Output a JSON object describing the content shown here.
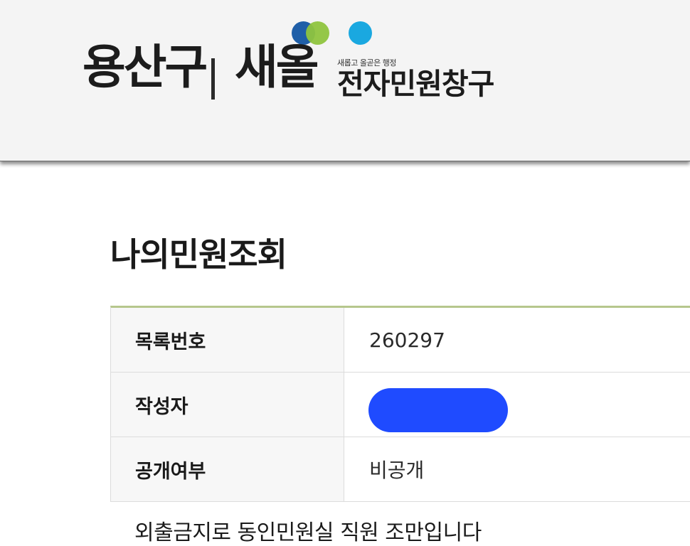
{
  "header": {
    "district_name": "용산구",
    "brand_name": "새올",
    "tagline": "새롭고 올곧은 행정",
    "service_name": "전자민원창구",
    "dot_colors": [
      "#1f5fa8",
      "#8fc43e",
      "#1aa8e0"
    ]
  },
  "page": {
    "title": "나의민원조회"
  },
  "info_table": {
    "rows": [
      {
        "label": "목록번호",
        "value": "260297"
      },
      {
        "label": "작성자",
        "value": ""
      },
      {
        "label": "공개여부",
        "value": "비공개"
      }
    ]
  },
  "body_text": {
    "partial_line": "외출금지로 동인민원실 직원 조만입니다"
  },
  "colors": {
    "table_top_border": "#b6c78d",
    "redaction": "#1f4bff",
    "header_bg": "#f4f4f4"
  }
}
